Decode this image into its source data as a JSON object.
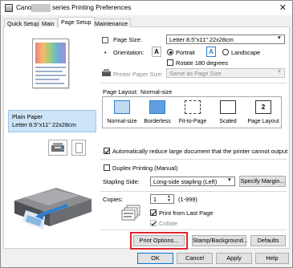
{
  "window": {
    "title_prefix": "Canon",
    "title_suffix": "series Printing Preferences",
    "close_glyph": "✕"
  },
  "tabs": [
    {
      "label": "Quick Setup",
      "active": false
    },
    {
      "label": "Main",
      "active": false
    },
    {
      "label": "Page Setup",
      "active": true
    },
    {
      "label": "Maintenance",
      "active": false
    }
  ],
  "preview": {
    "media_line1": "Plain Paper",
    "media_line2": "Letter 8.5\"x11\" 22x28cm"
  },
  "page_size": {
    "label": "Page Size:",
    "value": "Letter 8.5\"x11\" 22x28cm"
  },
  "orientation": {
    "label": "Orientation:",
    "portrait_label": "Portrait",
    "landscape_label": "Landscape",
    "portrait_selected": true,
    "rotate_label": "Rotate 180 degrees",
    "rotate_checked": false,
    "glyph_a": "A"
  },
  "printer_paper_size": {
    "label": "Printer Paper Size:",
    "value": "Same as Page Size",
    "disabled": true
  },
  "page_layout": {
    "label": "Page Layout:",
    "current": "Normal-size",
    "options": [
      {
        "label": "Normal-size",
        "selected": true
      },
      {
        "label": "Borderless"
      },
      {
        "label": "Fit-to-Page"
      },
      {
        "label": "Scaled"
      },
      {
        "label": "Page Layout",
        "badge": "2"
      }
    ]
  },
  "auto_reduce": {
    "label": "Automatically reduce large document that the printer cannot output",
    "checked": true
  },
  "duplex": {
    "label": "Duplex Printing (Manual)",
    "checked": false
  },
  "stapling": {
    "label": "Stapling Side:",
    "value": "Long-side stapling (Left)",
    "button": "Specify Margin..."
  },
  "copies": {
    "label": "Copies:",
    "value": "1",
    "range": "(1-999)",
    "print_from_last_label": "Print from Last Page",
    "print_from_last_checked": true,
    "collate_label": "Collate",
    "collate_checked": true,
    "collate_disabled": true
  },
  "panel_buttons": {
    "print_options": "Print Options...",
    "stamp_background": "Stamp/Background...",
    "defaults": "Defaults"
  },
  "dialog_buttons": {
    "ok": "OK",
    "cancel": "Cancel",
    "apply": "Apply",
    "help": "Help"
  },
  "colors": {
    "highlight": "#e0262d",
    "selection": "#cce4f7",
    "accent": "#0078d7"
  }
}
